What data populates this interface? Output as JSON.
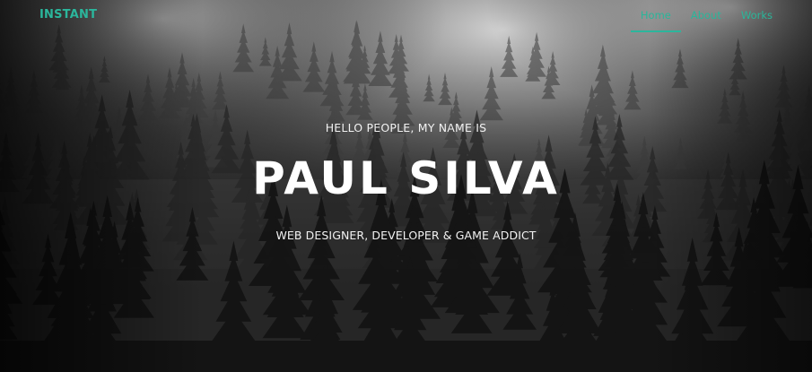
{
  "brand": {
    "label": "INSTANT"
  },
  "nav": {
    "items": [
      {
        "label": "Home",
        "active": true
      },
      {
        "label": "About",
        "active": false
      },
      {
        "label": "Works",
        "active": false
      }
    ]
  },
  "hero": {
    "intro": "HELLO PEOPLE, MY NAME IS",
    "name": "PAUL SILVA",
    "tagline": "WEB DESIGNER, DEVELOPER & GAME ADDICT",
    "background": "misty-forest-photo"
  },
  "colors": {
    "accent": "#2bb69c",
    "text": "#ffffff",
    "background": "#0c0c0c"
  }
}
